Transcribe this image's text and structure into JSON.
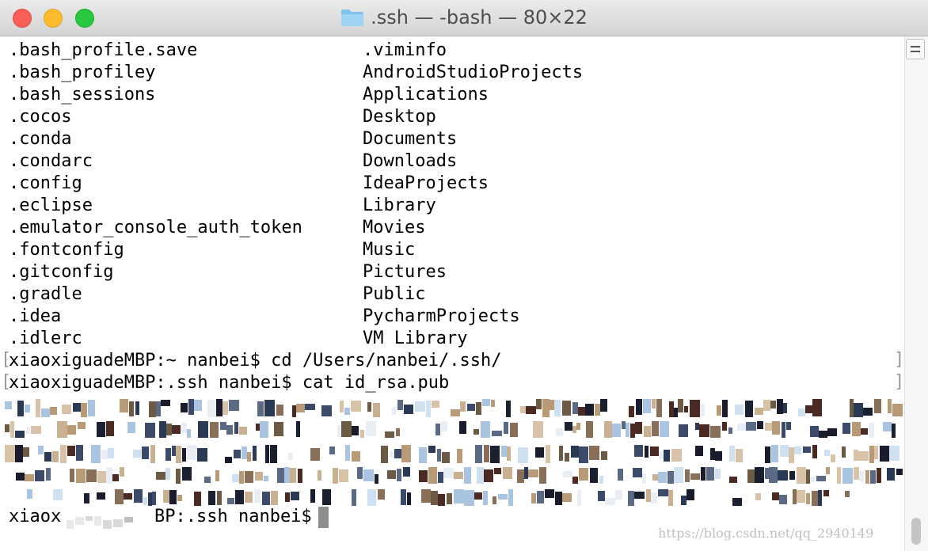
{
  "window": {
    "title": ".ssh — -bash — 80×22",
    "icon": "folder-icon"
  },
  "listing": {
    "left": [
      ".bash_profile.save",
      ".bash_profiley",
      ".bash_sessions",
      ".cocos",
      ".conda",
      ".condarc",
      ".config",
      ".eclipse",
      ".emulator_console_auth_token",
      ".fontconfig",
      ".gitconfig",
      ".gradle",
      ".idea",
      ".idlerc"
    ],
    "right": [
      ".viminfo",
      "AndroidStudioProjects",
      "Applications",
      "Desktop",
      "Documents",
      "Downloads",
      "IdeaProjects",
      "Library",
      "Movies",
      "Music",
      "Pictures",
      "Public",
      "PycharmProjects",
      "VM Library"
    ]
  },
  "commands": {
    "cd_line": "xiaoxiguadeMBP:~ nanbei$ cd /Users/nanbei/.ssh/",
    "cat_line": "xiaoxiguadeMBP:.ssh nanbei$ cat id_rsa.pub",
    "prompt_prefix": "xiaox",
    "prompt_suffix": "BP:.ssh nanbei$ "
  },
  "watermark": "https://blog.csdn.net/qq_2940149",
  "colors": {
    "text": "#000000",
    "cursor": "#8e8e8e",
    "close": "#fc5f57",
    "minimize": "#fdbc2e",
    "zoom": "#28c840"
  }
}
